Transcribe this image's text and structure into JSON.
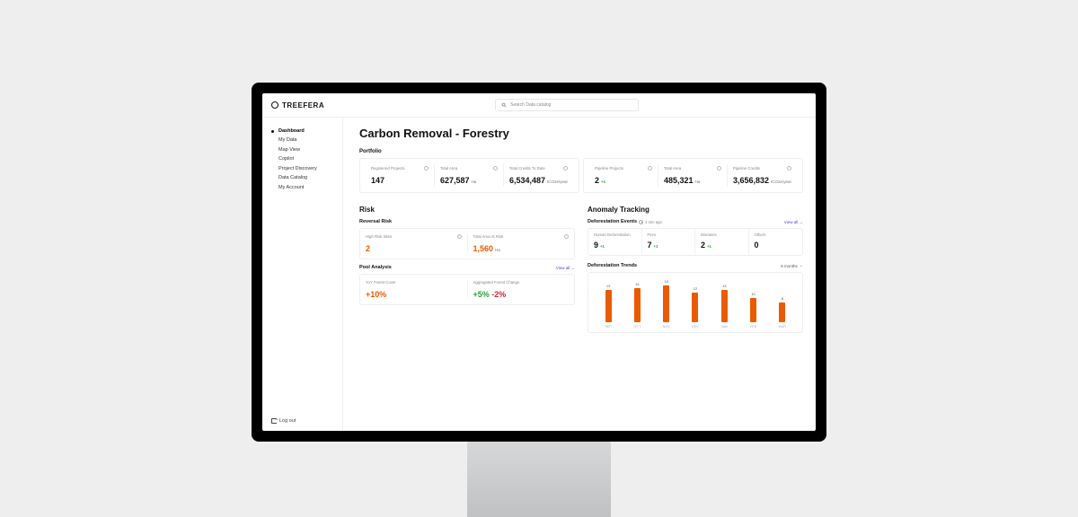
{
  "brand": {
    "name": "TREEFERA"
  },
  "search": {
    "placeholder": "Search Data catalog"
  },
  "sidebar": {
    "items": [
      {
        "label": "Dashboard",
        "active": true
      },
      {
        "label": "My Data"
      },
      {
        "label": "Map View"
      },
      {
        "label": "Copilot"
      },
      {
        "label": "Project Discovery"
      },
      {
        "label": "Data Catalog"
      },
      {
        "label": "My Account"
      }
    ],
    "logout": "Log out"
  },
  "page": {
    "title": "Carbon Removal - Forestry",
    "portfolio_label": "Portfolio",
    "risk_label": "Risk",
    "anomaly_label": "Anomaly Tracking"
  },
  "portfolio": {
    "left": [
      {
        "label": "Registered Projects",
        "value": "147",
        "unit": ""
      },
      {
        "label": "Total Area",
        "value": "627,587",
        "unit": "Ha"
      },
      {
        "label": "Total Credits To Date",
        "value": "6,534,487",
        "unit": "tCO2e/year"
      }
    ],
    "right": [
      {
        "label": "Pipeline Projects",
        "value": "2",
        "unit": "",
        "delta": "+1"
      },
      {
        "label": "Total Area",
        "value": "485,321",
        "unit": "Ha"
      },
      {
        "label": "Pipeline Credits",
        "value": "3,656,832",
        "unit": "tCO2e/year"
      }
    ]
  },
  "risk": {
    "reversal_label": "Reversal Risk",
    "reversal": [
      {
        "label": "High Risk Sites",
        "value": "2"
      },
      {
        "label": "Total Area At Risk",
        "value": "1,560",
        "unit": "Ha"
      }
    ],
    "pool_label": "Pool Analysis",
    "pool_viewall": "View all",
    "pool": [
      {
        "label": "YoY Forest Cover",
        "value": "+10%"
      },
      {
        "label": "Aggregated Forest Change",
        "value_pos": "+5%",
        "value_neg": "-2%"
      }
    ]
  },
  "anomaly": {
    "events_label": "Deforestation Events",
    "events_meta": "4 min ago",
    "events_viewall": "View all",
    "events": [
      {
        "label": "Human Deforestation",
        "value": "9",
        "delta": "+1"
      },
      {
        "label": "Fires",
        "value": "7",
        "delta": "+1"
      },
      {
        "label": "Diseases",
        "value": "2",
        "delta": "+1"
      },
      {
        "label": "Others",
        "value": "0"
      }
    ],
    "trends_label": "Deforestation Trends",
    "range": "6 months"
  },
  "chart_data": {
    "type": "bar",
    "title": "Deforestation Trends",
    "xlabel": "",
    "ylabel": "",
    "categories": [
      "SEP",
      "OCT",
      "NOV",
      "DEC",
      "JAN",
      "FEB",
      "MAR"
    ],
    "values": [
      13,
      14,
      15,
      12,
      13,
      10,
      8
    ],
    "ylim": [
      0,
      16
    ]
  }
}
